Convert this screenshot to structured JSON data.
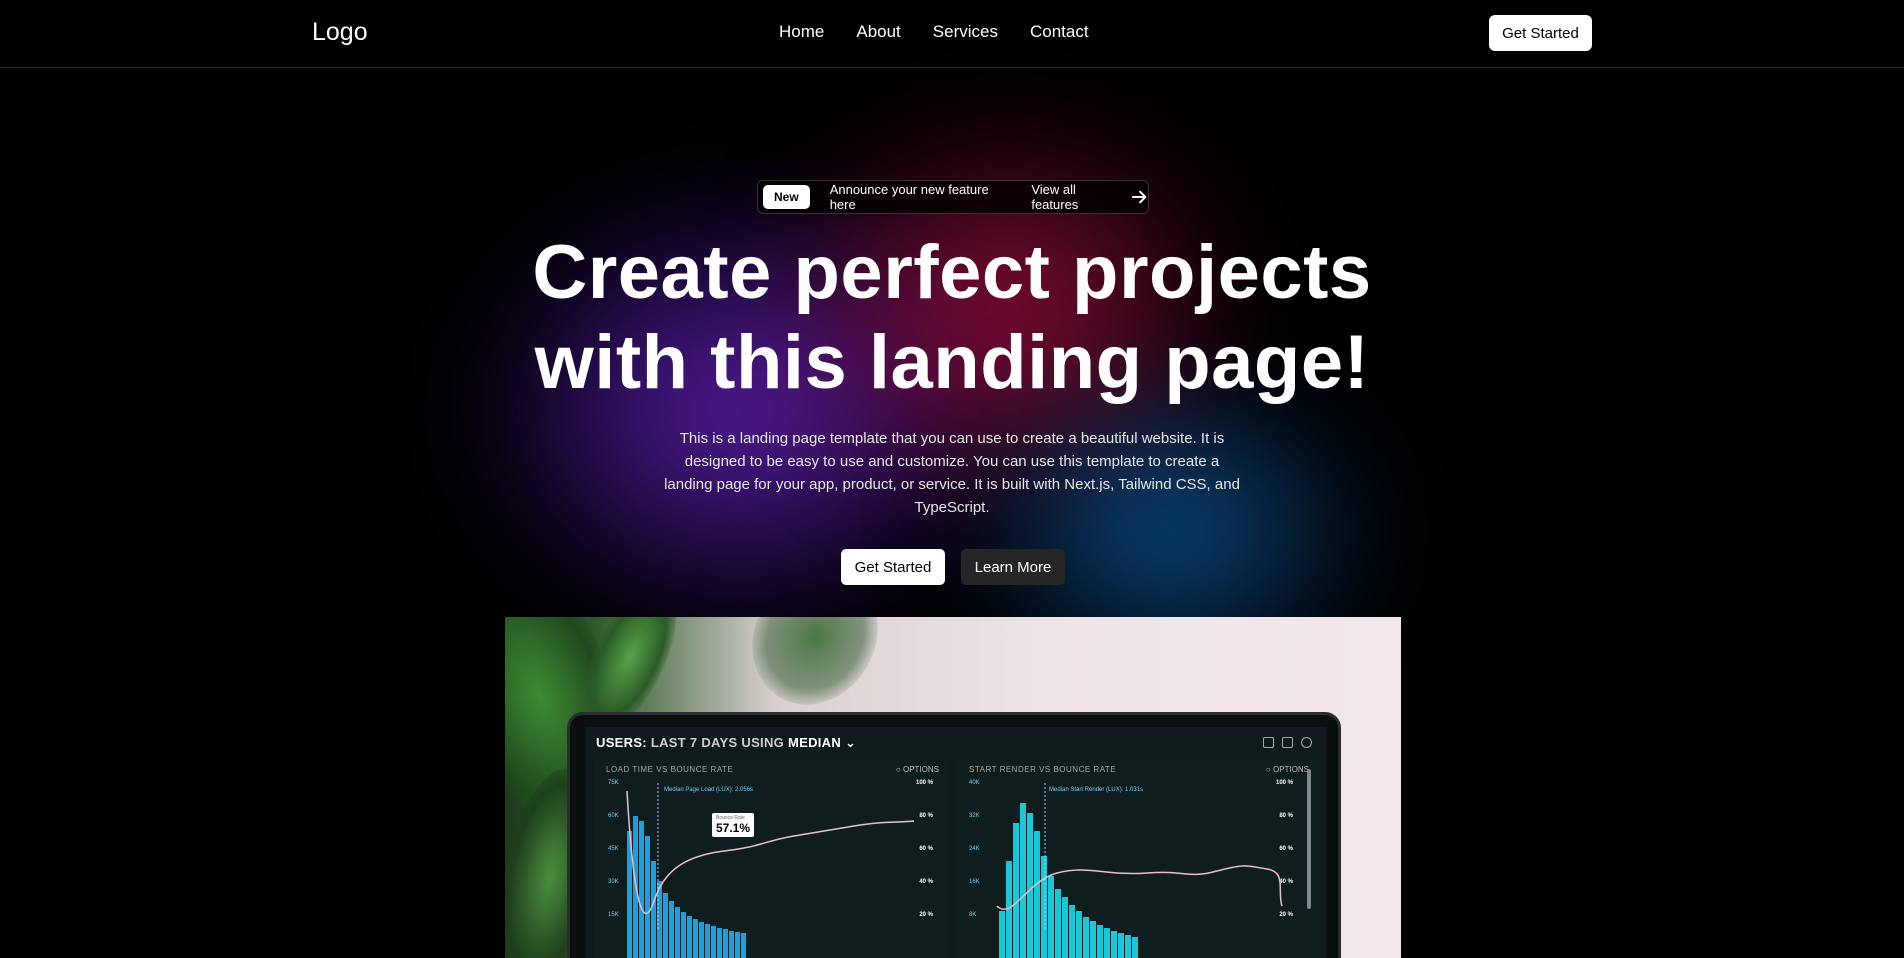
{
  "nav": {
    "logo": "Logo",
    "links": [
      "Home",
      "About",
      "Services",
      "Contact"
    ],
    "cta": "Get Started"
  },
  "announcement": {
    "badge": "New",
    "text": "Announce your new feature here",
    "link": "View all features",
    "icon": "arrow-right-icon"
  },
  "hero": {
    "headline_line1": "Create perfect projects",
    "headline_line2": "with this landing page!",
    "subtext": "This is a landing page template that you can use to create a beautiful website. It is designed to be easy to use and customize. You can use this template to create a landing page for your app, product, or service. It is built with Next.js, Tailwind CSS, and TypeScript.",
    "primary_cta": "Get Started",
    "secondary_cta": "Learn More"
  },
  "image": {
    "screen_title_a": "USERS:",
    "screen_title_b": "LAST 7 DAYS",
    "screen_title_c": "USING",
    "screen_title_d": "MEDIAN",
    "panel1_title": "LOAD TIME VS BOUNCE RATE",
    "panel1_option": "OPTIONS",
    "panel1_median": "Median Page Load (LUX): 2.056s",
    "panel1_left_ticks": [
      "75K",
      "60K",
      "45K",
      "30K",
      "15K"
    ],
    "panel1_right_ticks": [
      "100 %",
      "80 %",
      "60 %",
      "40 %",
      "20 %"
    ],
    "tooltip_label": "Bounce Rate",
    "tooltip_value": "57.1%",
    "panel2_title": "START RENDER VS BOUNCE RATE",
    "panel2_option": "OPTIONS",
    "panel2_median": "Median Start Render (LUX): 1.031s",
    "panel2_left_ticks": [
      "40K",
      "32K",
      "24K",
      "16K",
      "8K"
    ],
    "panel2_right_ticks": [
      "100 %",
      "80 %",
      "60 %",
      "40 %",
      "20 %"
    ]
  },
  "colors": {
    "background": "#000000",
    "button_light": "#ffffff",
    "button_dark": "#262626",
    "glow_purple": "#6e28c8",
    "glow_red": "#c81450",
    "glow_blue": "#1478c8"
  }
}
